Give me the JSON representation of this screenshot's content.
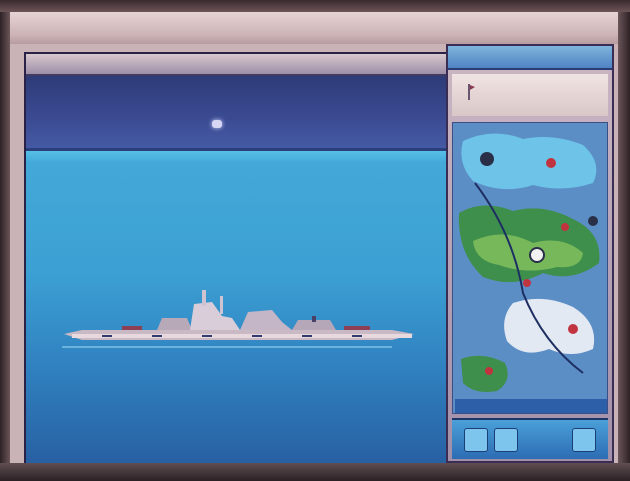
{
  "window": {
    "title": ""
  },
  "viewport": {
    "title": "",
    "status_text": ""
  },
  "sidebar": {
    "title": ""
  },
  "colors": {
    "sky": "#3b4b93",
    "sea": "#3b9fd3",
    "panel": "#cbb7c3",
    "map_water": "#5c8ec6",
    "map_land": "#3f8f4c",
    "marker": "#c23340"
  },
  "icons": {
    "sky_point": "star-icon",
    "panel_top": "flag-icon",
    "markers": "map-marker-icon"
  }
}
